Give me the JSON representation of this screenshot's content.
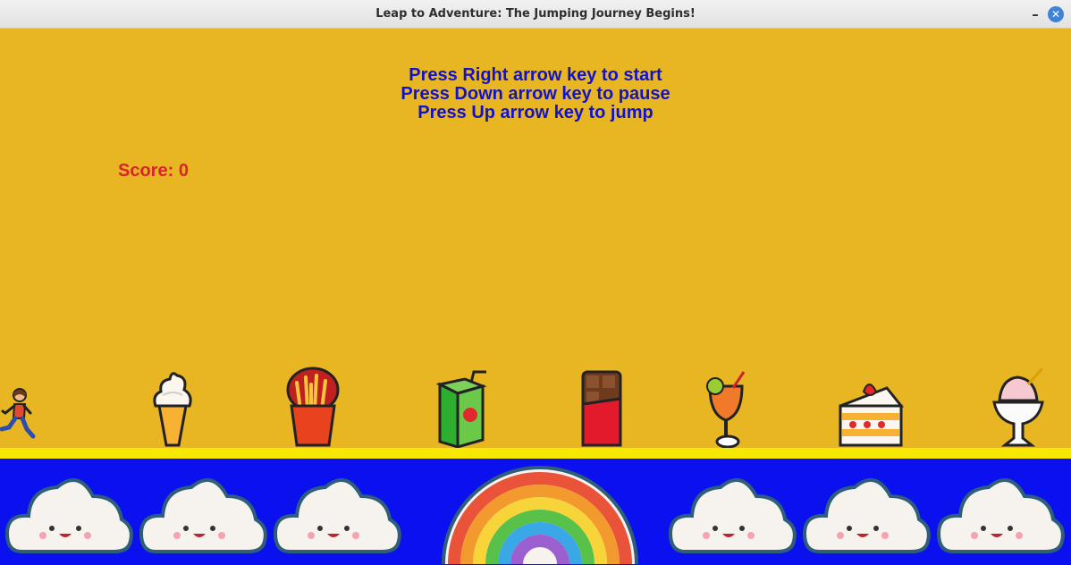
{
  "window": {
    "title": "Leap to Adventure: The Jumping Journey Begins!"
  },
  "controls": {
    "minimize_symbol": "✕",
    "close_symbol": "✕"
  },
  "instructions": [
    "Press Right arrow key to start",
    "Press Down arrow key to pause",
    "Press Up arrow key to jump"
  ],
  "score": {
    "label": "Score:",
    "value": "0"
  },
  "colors": {
    "background": "#e8b623",
    "instruction_text": "#1212c8",
    "score_text": "#d9232e",
    "track": "#f6e800",
    "floor": "#0a11ee"
  },
  "player": {
    "icon": "running-person-icon"
  },
  "obstacles": [
    {
      "name": "ice-cream-cone-icon"
    },
    {
      "name": "french-fries-icon"
    },
    {
      "name": "juice-box-icon"
    },
    {
      "name": "chocolate-bar-icon"
    },
    {
      "name": "tropical-drink-icon"
    },
    {
      "name": "strawberry-cake-icon"
    },
    {
      "name": "shaved-ice-icon"
    }
  ],
  "decorations": [
    {
      "name": "smiling-cloud-icon"
    },
    {
      "name": "smiling-cloud-icon"
    },
    {
      "name": "smiling-cloud-icon"
    },
    {
      "name": "rainbow-icon"
    },
    {
      "name": "smiling-cloud-icon"
    },
    {
      "name": "smiling-cloud-icon"
    },
    {
      "name": "smiling-cloud-icon"
    }
  ]
}
